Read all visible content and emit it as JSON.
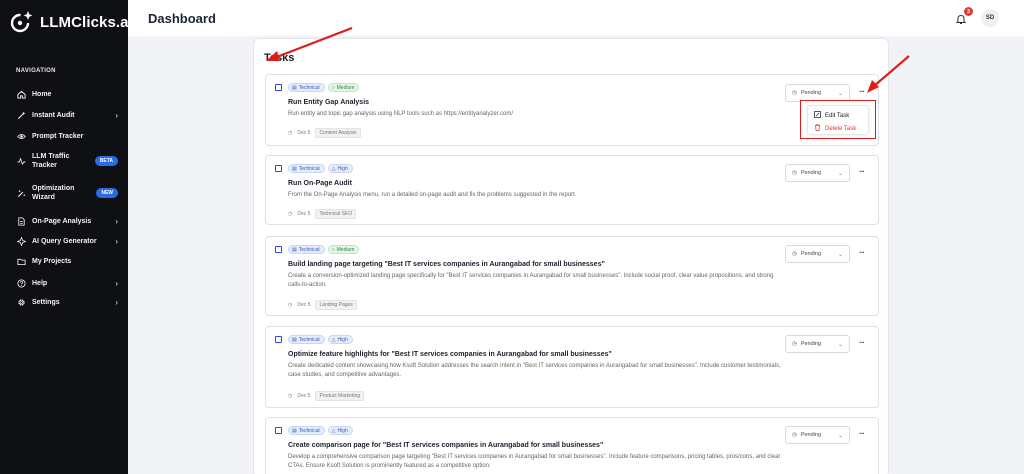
{
  "brand": {
    "name": "LLMClicks.ai"
  },
  "sidebar": {
    "heading": "NAVIGATION",
    "items": [
      {
        "label": "Home",
        "icon": "home-icon",
        "chevron": false
      },
      {
        "label": "Instant Audit",
        "icon": "wand-icon",
        "chevron": true
      },
      {
        "label": "Prompt Tracker",
        "icon": "eye-icon",
        "chevron": false
      },
      {
        "label": "LLM Traffic\nTracker",
        "icon": "activity-icon",
        "badge": "BETA"
      },
      {
        "label": "Optimization\nWizard",
        "icon": "magic-icon",
        "badge": "NEW"
      },
      {
        "label": "On-Page Analysis",
        "icon": "document-icon",
        "chevron": true
      },
      {
        "label": "AI Query Generator",
        "icon": "sparkle-icon",
        "chevron": true
      },
      {
        "label": "My Projects",
        "icon": "folder-icon",
        "chevron": false
      },
      {
        "label": "Help",
        "icon": "help-icon",
        "chevron": true
      },
      {
        "label": "Settings",
        "icon": "gear-icon",
        "chevron": true
      }
    ]
  },
  "header": {
    "title": "Dashboard",
    "notifications": "3",
    "avatar": "SD"
  },
  "panel": {
    "title": "Tasks"
  },
  "chevron": "›",
  "dropdown_caret": "⌄",
  "more": "···",
  "tasks": [
    {
      "tags": [
        "Technical",
        "Medium"
      ],
      "title": "Run Entity Gap Analysis",
      "description": "Run entity and topic gap analysis using NLP tools such as https://entityanalyzer.com/",
      "date": "Dec 5",
      "category": "Content Analysis",
      "status": "Pending"
    },
    {
      "tags": [
        "Technical",
        "High"
      ],
      "title": "Run On-Page Audit",
      "description": "From the On-Page Analysis menu, run a detailed on-page audit and fix the problems suggested in the report.",
      "date": "Dec 5",
      "category": "Technical SEO",
      "status": "Pending"
    },
    {
      "tags": [
        "Technical",
        "Medium"
      ],
      "title": "Build landing page targeting \"Best IT services companies in Aurangabad for small businesses\"",
      "description": "Create a conversion-optimized landing page specifically for \"Best IT services companies in Aurangabad for small businesses\". Include social proof, clear value propositions, and strong calls-to-action.",
      "date": "Dec 5",
      "category": "Landing Pages",
      "status": "Pending"
    },
    {
      "tags": [
        "Technical",
        "High"
      ],
      "title": "Optimize feature highlights for \"Best IT services companies in Aurangabad for small businesses\"",
      "description": "Create dedicated content showcasing how Ksoft Solution addresses the search intent in \"Best IT services companies in Aurangabad for small businesses\". Include customer testimonials, case studies, and competitive advantages.",
      "date": "Dec 5",
      "category": "Product Marketing",
      "status": "Pending"
    },
    {
      "tags": [
        "Technical",
        "High"
      ],
      "title": "Create comparison page for \"Best IT services companies in Aurangabad for small businesses\"",
      "description": "Develop a comprehensive comparison page targeting \"Best IT services companies in Aurangabad for small businesses\". Include feature comparisons, pricing tables, pros/cons, and clear CTAs. Ensure Ksoft Solution is prominently featured as a competitive option.",
      "status": "Pending"
    }
  ],
  "menu": {
    "edit": "Edit Task",
    "delete": "Delete Task"
  },
  "colors": {
    "sidebar": "#0e1014",
    "accent": "#2d6ae8",
    "danger": "#e53935",
    "annotation": "#e21b1b"
  }
}
